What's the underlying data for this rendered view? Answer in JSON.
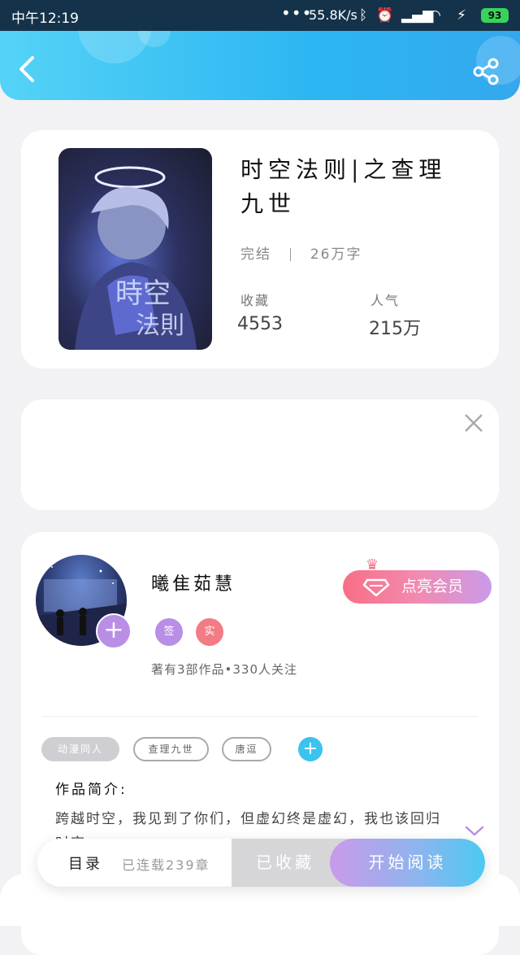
{
  "status_bar": {
    "time": "中午12:19",
    "network_speed": "55.8K/s",
    "battery": "93",
    "colors": {
      "background": "#14334a",
      "battery": "#39d35c"
    }
  },
  "header": {
    "back_icon": "chevron-left-icon",
    "share_icon": "share-icon",
    "gradient": [
      "#55d3f7",
      "#34a8ee"
    ]
  },
  "book": {
    "title": "时空法则|之查理九世",
    "status": "完结",
    "word_count": "26万字",
    "favorites_label": "收藏",
    "favorites_value": "4553",
    "popularity_label": "人气",
    "popularity_value": "215万"
  },
  "author": {
    "name": "曦隹茹慧",
    "badge_sign": "签",
    "badge_real": "实",
    "stats": "著有3部作品•330人关注",
    "vip_button": "点亮会员"
  },
  "tags": [
    "动漫同人",
    "查理九世",
    "唐逗"
  ],
  "intro": {
    "title": "作品简介:",
    "text": "跨越时空，我见到了你们，但虚幻终是虚幻，我也该回归时空。"
  },
  "bottom_bar": {
    "toc_label": "目录",
    "serial_info": "已连载239章",
    "favorited_label": "已收藏",
    "start_reading_label": "开始阅读"
  },
  "colors": {
    "accent_blue": "#3ac3ef",
    "accent_purple": "#b98ee6",
    "vip_pink": "#f86e86"
  }
}
